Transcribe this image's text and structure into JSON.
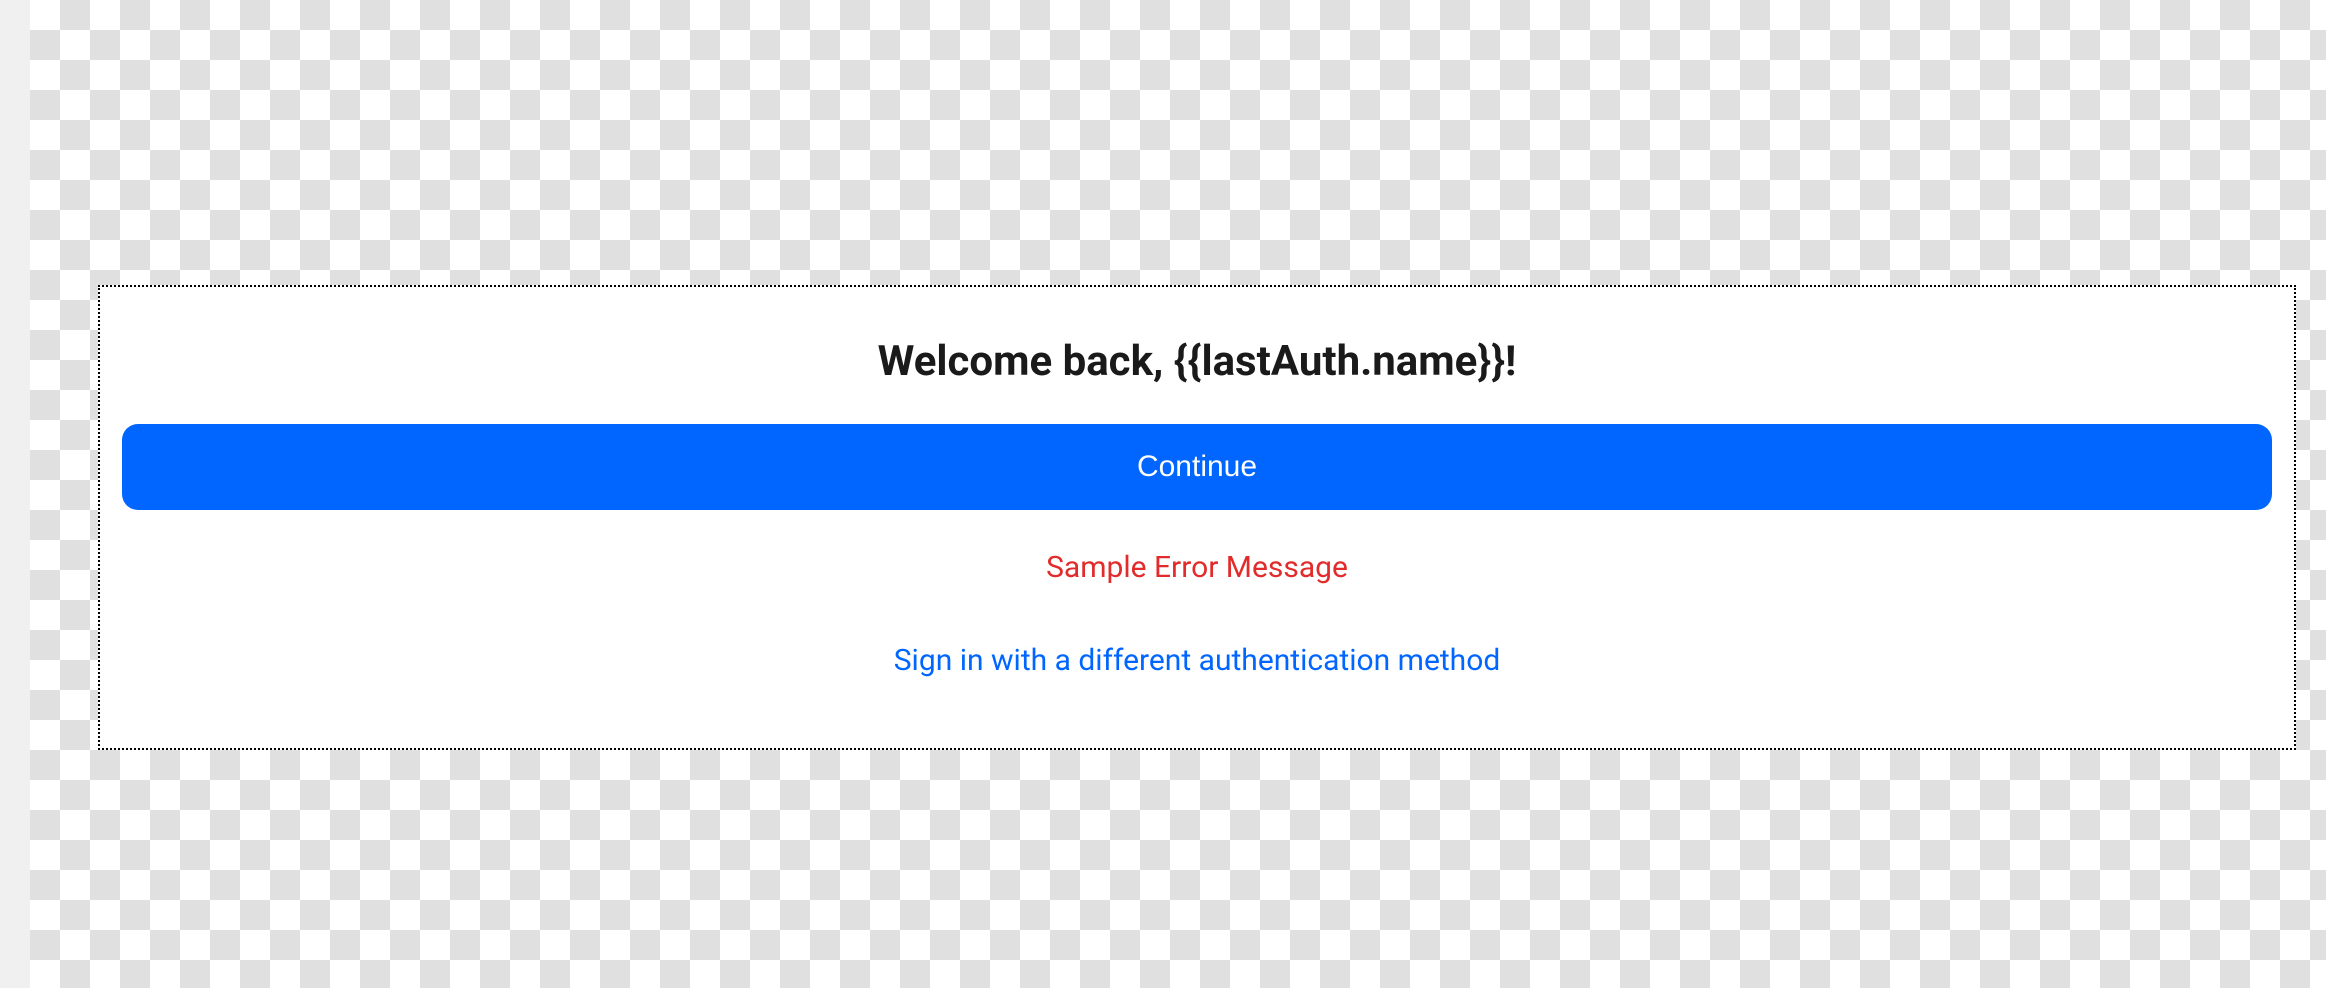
{
  "auth": {
    "welcome_heading": "Welcome back, {{lastAuth.name}}!",
    "continue_label": "Continue",
    "error_message": "Sample Error Message",
    "alt_signin_label": "Sign in with a different authentication method"
  }
}
